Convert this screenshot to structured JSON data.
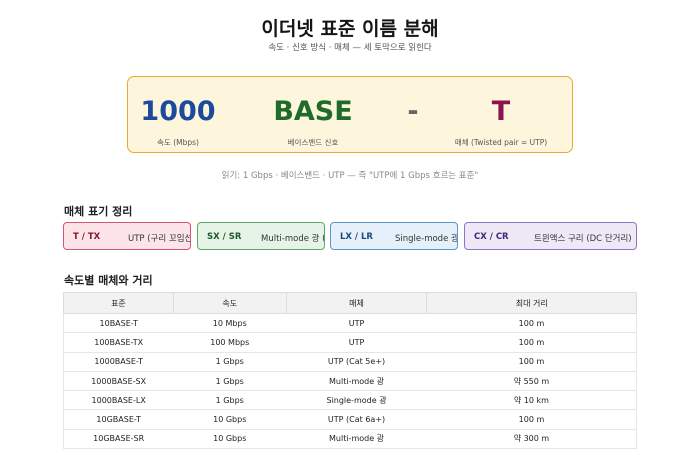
{
  "title": "이더넷 표준 이름 분해",
  "subtitle": "속도 · 신호 방식 · 매체 — 세 토막으로 읽힌다",
  "breakdown": {
    "speed": {
      "value": "1000",
      "caption": "속도 (Mbps)"
    },
    "signal": {
      "value": "BASE",
      "caption": "베이스밴드 신호"
    },
    "separator": "-",
    "media": {
      "value": "T",
      "caption": "매체 (Twisted pair = UTP)"
    },
    "colors": {
      "speed": "#1c4a9c",
      "signal": "#1e6b2a",
      "media": "#8a1450",
      "border": "#e8a935"
    }
  },
  "reading": "읽기: 1 Gbps · 베이스밴드 · UTP — 즉 \"UTP에 1 Gbps 흐르는 표준\"",
  "media_section": {
    "heading": "매체 표기 정리",
    "chips": [
      {
        "code": "T / TX",
        "desc": "UTP (구리 꼬임선)"
      },
      {
        "code": "SX / SR",
        "desc": "Multi-mode 광 (단거리)"
      },
      {
        "code": "LX / LR",
        "desc": "Single-mode 광 (장거리)"
      },
      {
        "code": "CX / CR",
        "desc": "트윈액스 구리 (DC 단거리)"
      }
    ]
  },
  "speed_section": {
    "heading": "속도별 매체와 거리",
    "columns": [
      "표준",
      "속도",
      "매체",
      "최대 거리"
    ],
    "rows": [
      [
        "10BASE-T",
        "10 Mbps",
        "UTP",
        "100 m"
      ],
      [
        "100BASE-TX",
        "100 Mbps",
        "UTP",
        "100 m"
      ],
      [
        "1000BASE-T",
        "1 Gbps",
        "UTP (Cat 5e+)",
        "100 m"
      ],
      [
        "1000BASE-SX",
        "1 Gbps",
        "Multi-mode 광",
        "약 550 m"
      ],
      [
        "1000BASE-LX",
        "1 Gbps",
        "Single-mode 광",
        "약 10 km"
      ],
      [
        "10GBASE-T",
        "10 Gbps",
        "UTP (Cat 6a+)",
        "100 m"
      ],
      [
        "10GBASE-SR",
        "10 Gbps",
        "Multi-mode 광",
        "약 300 m"
      ]
    ]
  }
}
